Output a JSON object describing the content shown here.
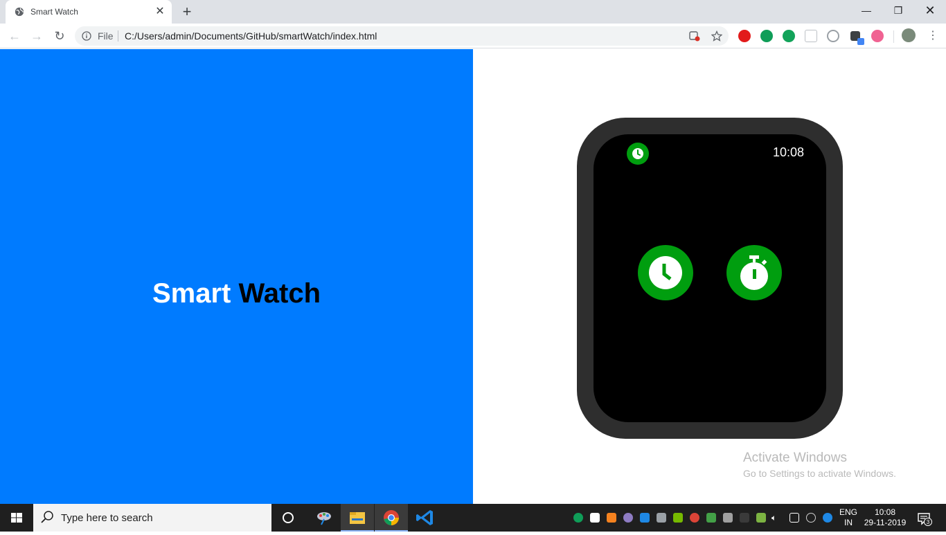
{
  "browser": {
    "tab_title": "Smart Watch",
    "address_chip": "File",
    "url": "C:/Users/admin/Documents/GitHub/smartWatch/index.html"
  },
  "page": {
    "title_part1": "Smart",
    "title_part2": "Watch",
    "watch": {
      "time": "10:08",
      "apps": [
        "clock-app",
        "stopwatch-app"
      ],
      "accent_color": "#009e0f",
      "body_color": "#2e2e2e"
    },
    "left_bg_color": "#007bff"
  },
  "watermark": {
    "title": "Activate Windows",
    "subtitle": "Go to Settings to activate Windows."
  },
  "taskbar": {
    "search_placeholder": "Type here to search",
    "language": "ENG",
    "region": "IN",
    "time": "10:08",
    "date": "29-11-2019",
    "notification_count": "3"
  }
}
